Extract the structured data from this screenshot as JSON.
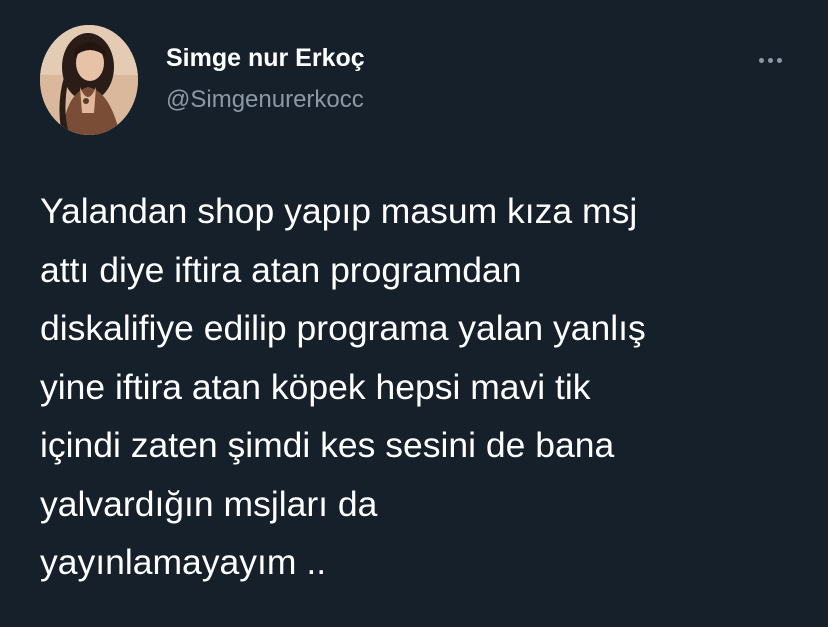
{
  "author": {
    "display_name": "Simge nur Erkoç",
    "handle": "@Simgenurerkocc"
  },
  "more_icon": "more-horizontal-icon",
  "tweet": {
    "lines": [
      "Yalandan shop yapıp masum kıza msj",
      "attı diye iftira atan programdan",
      "diskalifiye edilip programa yalan yanlış",
      "yine iftira atan köpek hepsi mavi tik",
      "içindi zaten şimdi kes sesini de bana",
      "yalvardığın msjları da",
      "yayınlamayayım .."
    ]
  },
  "colors": {
    "background": "#15202b",
    "primary_text": "#ffffff",
    "secondary_text": "#8b98a5"
  }
}
